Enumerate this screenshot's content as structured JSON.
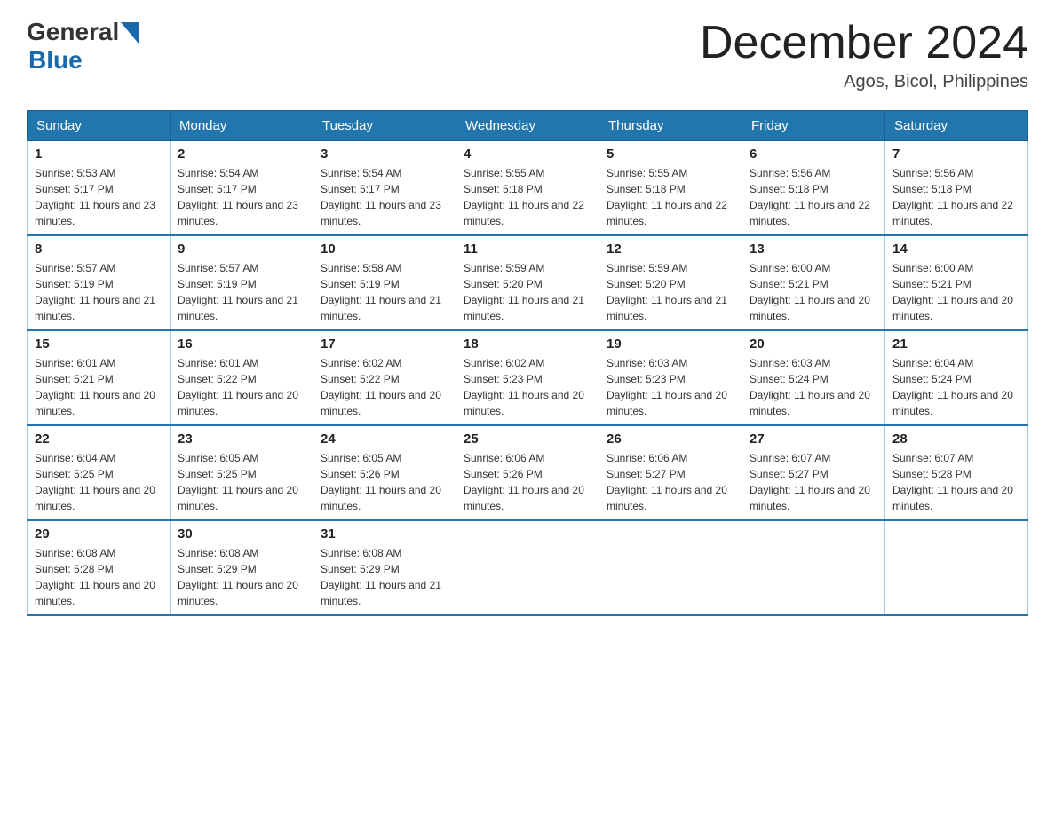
{
  "header": {
    "logo_general": "General",
    "logo_blue": "Blue",
    "month_title": "December 2024",
    "subtitle": "Agos, Bicol, Philippines"
  },
  "weekdays": [
    "Sunday",
    "Monday",
    "Tuesday",
    "Wednesday",
    "Thursday",
    "Friday",
    "Saturday"
  ],
  "weeks": [
    [
      {
        "day": "1",
        "sunrise": "Sunrise: 5:53 AM",
        "sunset": "Sunset: 5:17 PM",
        "daylight": "Daylight: 11 hours and 23 minutes."
      },
      {
        "day": "2",
        "sunrise": "Sunrise: 5:54 AM",
        "sunset": "Sunset: 5:17 PM",
        "daylight": "Daylight: 11 hours and 23 minutes."
      },
      {
        "day": "3",
        "sunrise": "Sunrise: 5:54 AM",
        "sunset": "Sunset: 5:17 PM",
        "daylight": "Daylight: 11 hours and 23 minutes."
      },
      {
        "day": "4",
        "sunrise": "Sunrise: 5:55 AM",
        "sunset": "Sunset: 5:18 PM",
        "daylight": "Daylight: 11 hours and 22 minutes."
      },
      {
        "day": "5",
        "sunrise": "Sunrise: 5:55 AM",
        "sunset": "Sunset: 5:18 PM",
        "daylight": "Daylight: 11 hours and 22 minutes."
      },
      {
        "day": "6",
        "sunrise": "Sunrise: 5:56 AM",
        "sunset": "Sunset: 5:18 PM",
        "daylight": "Daylight: 11 hours and 22 minutes."
      },
      {
        "day": "7",
        "sunrise": "Sunrise: 5:56 AM",
        "sunset": "Sunset: 5:18 PM",
        "daylight": "Daylight: 11 hours and 22 minutes."
      }
    ],
    [
      {
        "day": "8",
        "sunrise": "Sunrise: 5:57 AM",
        "sunset": "Sunset: 5:19 PM",
        "daylight": "Daylight: 11 hours and 21 minutes."
      },
      {
        "day": "9",
        "sunrise": "Sunrise: 5:57 AM",
        "sunset": "Sunset: 5:19 PM",
        "daylight": "Daylight: 11 hours and 21 minutes."
      },
      {
        "day": "10",
        "sunrise": "Sunrise: 5:58 AM",
        "sunset": "Sunset: 5:19 PM",
        "daylight": "Daylight: 11 hours and 21 minutes."
      },
      {
        "day": "11",
        "sunrise": "Sunrise: 5:59 AM",
        "sunset": "Sunset: 5:20 PM",
        "daylight": "Daylight: 11 hours and 21 minutes."
      },
      {
        "day": "12",
        "sunrise": "Sunrise: 5:59 AM",
        "sunset": "Sunset: 5:20 PM",
        "daylight": "Daylight: 11 hours and 21 minutes."
      },
      {
        "day": "13",
        "sunrise": "Sunrise: 6:00 AM",
        "sunset": "Sunset: 5:21 PM",
        "daylight": "Daylight: 11 hours and 20 minutes."
      },
      {
        "day": "14",
        "sunrise": "Sunrise: 6:00 AM",
        "sunset": "Sunset: 5:21 PM",
        "daylight": "Daylight: 11 hours and 20 minutes."
      }
    ],
    [
      {
        "day": "15",
        "sunrise": "Sunrise: 6:01 AM",
        "sunset": "Sunset: 5:21 PM",
        "daylight": "Daylight: 11 hours and 20 minutes."
      },
      {
        "day": "16",
        "sunrise": "Sunrise: 6:01 AM",
        "sunset": "Sunset: 5:22 PM",
        "daylight": "Daylight: 11 hours and 20 minutes."
      },
      {
        "day": "17",
        "sunrise": "Sunrise: 6:02 AM",
        "sunset": "Sunset: 5:22 PM",
        "daylight": "Daylight: 11 hours and 20 minutes."
      },
      {
        "day": "18",
        "sunrise": "Sunrise: 6:02 AM",
        "sunset": "Sunset: 5:23 PM",
        "daylight": "Daylight: 11 hours and 20 minutes."
      },
      {
        "day": "19",
        "sunrise": "Sunrise: 6:03 AM",
        "sunset": "Sunset: 5:23 PM",
        "daylight": "Daylight: 11 hours and 20 minutes."
      },
      {
        "day": "20",
        "sunrise": "Sunrise: 6:03 AM",
        "sunset": "Sunset: 5:24 PM",
        "daylight": "Daylight: 11 hours and 20 minutes."
      },
      {
        "day": "21",
        "sunrise": "Sunrise: 6:04 AM",
        "sunset": "Sunset: 5:24 PM",
        "daylight": "Daylight: 11 hours and 20 minutes."
      }
    ],
    [
      {
        "day": "22",
        "sunrise": "Sunrise: 6:04 AM",
        "sunset": "Sunset: 5:25 PM",
        "daylight": "Daylight: 11 hours and 20 minutes."
      },
      {
        "day": "23",
        "sunrise": "Sunrise: 6:05 AM",
        "sunset": "Sunset: 5:25 PM",
        "daylight": "Daylight: 11 hours and 20 minutes."
      },
      {
        "day": "24",
        "sunrise": "Sunrise: 6:05 AM",
        "sunset": "Sunset: 5:26 PM",
        "daylight": "Daylight: 11 hours and 20 minutes."
      },
      {
        "day": "25",
        "sunrise": "Sunrise: 6:06 AM",
        "sunset": "Sunset: 5:26 PM",
        "daylight": "Daylight: 11 hours and 20 minutes."
      },
      {
        "day": "26",
        "sunrise": "Sunrise: 6:06 AM",
        "sunset": "Sunset: 5:27 PM",
        "daylight": "Daylight: 11 hours and 20 minutes."
      },
      {
        "day": "27",
        "sunrise": "Sunrise: 6:07 AM",
        "sunset": "Sunset: 5:27 PM",
        "daylight": "Daylight: 11 hours and 20 minutes."
      },
      {
        "day": "28",
        "sunrise": "Sunrise: 6:07 AM",
        "sunset": "Sunset: 5:28 PM",
        "daylight": "Daylight: 11 hours and 20 minutes."
      }
    ],
    [
      {
        "day": "29",
        "sunrise": "Sunrise: 6:08 AM",
        "sunset": "Sunset: 5:28 PM",
        "daylight": "Daylight: 11 hours and 20 minutes."
      },
      {
        "day": "30",
        "sunrise": "Sunrise: 6:08 AM",
        "sunset": "Sunset: 5:29 PM",
        "daylight": "Daylight: 11 hours and 20 minutes."
      },
      {
        "day": "31",
        "sunrise": "Sunrise: 6:08 AM",
        "sunset": "Sunset: 5:29 PM",
        "daylight": "Daylight: 11 hours and 21 minutes."
      },
      null,
      null,
      null,
      null
    ]
  ]
}
